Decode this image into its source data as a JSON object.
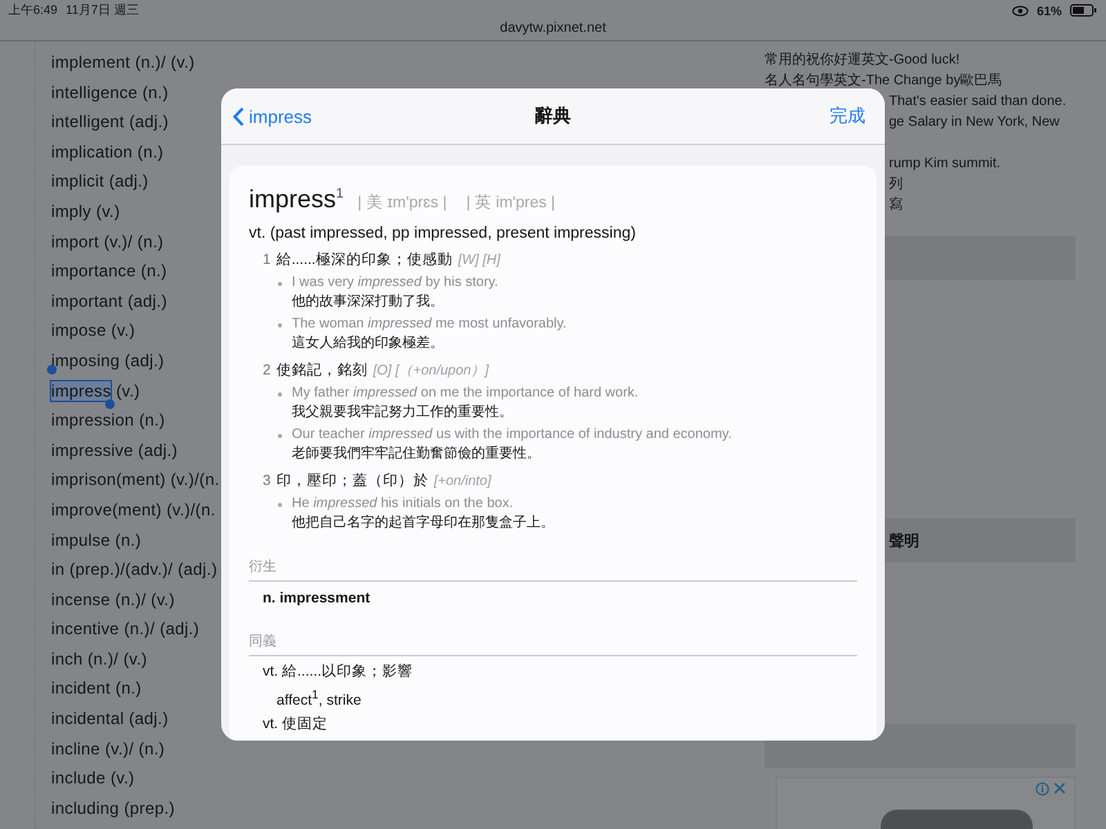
{
  "status_bar": {
    "time": "上午6:49",
    "date": "11月7日 週三",
    "battery": "61%"
  },
  "address_bar": {
    "url": "davytw.pixnet.net"
  },
  "word_list": [
    {
      "word": "implement",
      "pos": "(n.)/ (v.)",
      "selected": false
    },
    {
      "word": "intelligence",
      "pos": "(n.)",
      "selected": false
    },
    {
      "word": "intelligent",
      "pos": "(adj.)",
      "selected": false
    },
    {
      "word": "implication",
      "pos": "(n.)",
      "selected": false
    },
    {
      "word": "implicit",
      "pos": "(adj.)",
      "selected": false
    },
    {
      "word": "imply",
      "pos": "(v.)",
      "selected": false
    },
    {
      "word": "import",
      "pos": "(v.)/ (n.)",
      "selected": false
    },
    {
      "word": "importance",
      "pos": "(n.)",
      "selected": false
    },
    {
      "word": "important",
      "pos": "(adj.)",
      "selected": false
    },
    {
      "word": "impose",
      "pos": "(v.)",
      "selected": false
    },
    {
      "word": "imposing",
      "pos": "(adj.)",
      "selected": false
    },
    {
      "word": "impress",
      "pos": "(v.)",
      "selected": true
    },
    {
      "word": "impression",
      "pos": "(n.)",
      "selected": false
    },
    {
      "word": "impressive",
      "pos": "(adj.)",
      "selected": false
    },
    {
      "word": "imprison(ment)",
      "pos": "(v.)/(n.",
      "selected": false
    },
    {
      "word": "improve(ment)",
      "pos": "(v.)/(n.",
      "selected": false
    },
    {
      "word": "impulse",
      "pos": "(n.)",
      "selected": false
    },
    {
      "word": "in",
      "pos": "(prep.)/(adv.)/ (adj.)",
      "selected": false
    },
    {
      "word": "incense",
      "pos": "(n.)/ (v.)",
      "selected": false
    },
    {
      "word": "incentive",
      "pos": "(n.)/ (adj.)",
      "selected": false
    },
    {
      "word": "inch",
      "pos": "(n.)/ (v.)",
      "selected": false
    },
    {
      "word": "incident",
      "pos": "(n.)",
      "selected": false
    },
    {
      "word": "incidental",
      "pos": "(adj.)",
      "selected": false
    },
    {
      "word": "incline",
      "pos": "(v.)/ (n.)",
      "selected": false
    },
    {
      "word": "include",
      "pos": "(v.)",
      "selected": false
    },
    {
      "word": "including",
      "pos": "(prep.)",
      "selected": false
    }
  ],
  "sidebar": {
    "links": [
      {
        "text": "常用的祝你好運英文-Good luck!",
        "covered": false
      },
      {
        "text": "名人名句學英文-The Change by歐巴馬",
        "covered": false
      },
      {
        "text": "That's easier said than done.",
        "covered": true
      },
      {
        "text": "ge Salary in New York, New",
        "covered": true
      },
      {
        "text": "rump Kim summit.",
        "covered": true
      },
      {
        "text": "列",
        "covered": true
      },
      {
        "text": "寫",
        "covered": true
      }
    ],
    "section_heading": "聲明"
  },
  "dictionary": {
    "back": "impress",
    "title": "辭典",
    "done": "完成",
    "headword": "impress",
    "homograph": "1",
    "pronunciations": [
      "| 美 ɪm'prɛs |",
      "| 英 im'pres |"
    ],
    "inflections": "vt. (past impressed, pp impressed, present impressing)",
    "senses": [
      {
        "number": "1",
        "definition": "給......極深的印象；使感動",
        "grammar": "[W] [H]",
        "examples": [
          {
            "en": "I was very *impressed* by his story.",
            "zh": "他的故事深深打動了我。"
          },
          {
            "en": "The woman *impressed* me most unfavorably.",
            "zh": "這女人給我的印象極差。"
          }
        ]
      },
      {
        "number": "2",
        "definition": "使銘記，銘刻",
        "grammar": "[O] [（+on/upon）]",
        "examples": [
          {
            "en": "My father *impressed* on me the importance of hard work.",
            "zh": "我父親要我牢記努力工作的重要性。"
          },
          {
            "en": "Our teacher *impressed* us with the importance of industry and economy.",
            "zh": "老師要我們牢牢記住勤奮節儉的重要性。"
          }
        ]
      },
      {
        "number": "3",
        "definition": "印，壓印；蓋（印）於",
        "grammar": "[+on/into]",
        "examples": [
          {
            "en": "He *impressed* his initials on the box.",
            "zh": "他把自己名字的起首字母印在那隻盒子上。"
          }
        ]
      }
    ],
    "derivatives": {
      "heading": "衍生",
      "items": [
        "n. impressment"
      ]
    },
    "synonyms": {
      "heading": "同義",
      "items": [
        {
          "kind": "sense",
          "text": "vt. 給......以印象；影響"
        },
        {
          "kind": "words",
          "text": "affect$^{1}$, strike"
        },
        {
          "kind": "sense",
          "text": "vt. 使固定"
        }
      ]
    }
  }
}
